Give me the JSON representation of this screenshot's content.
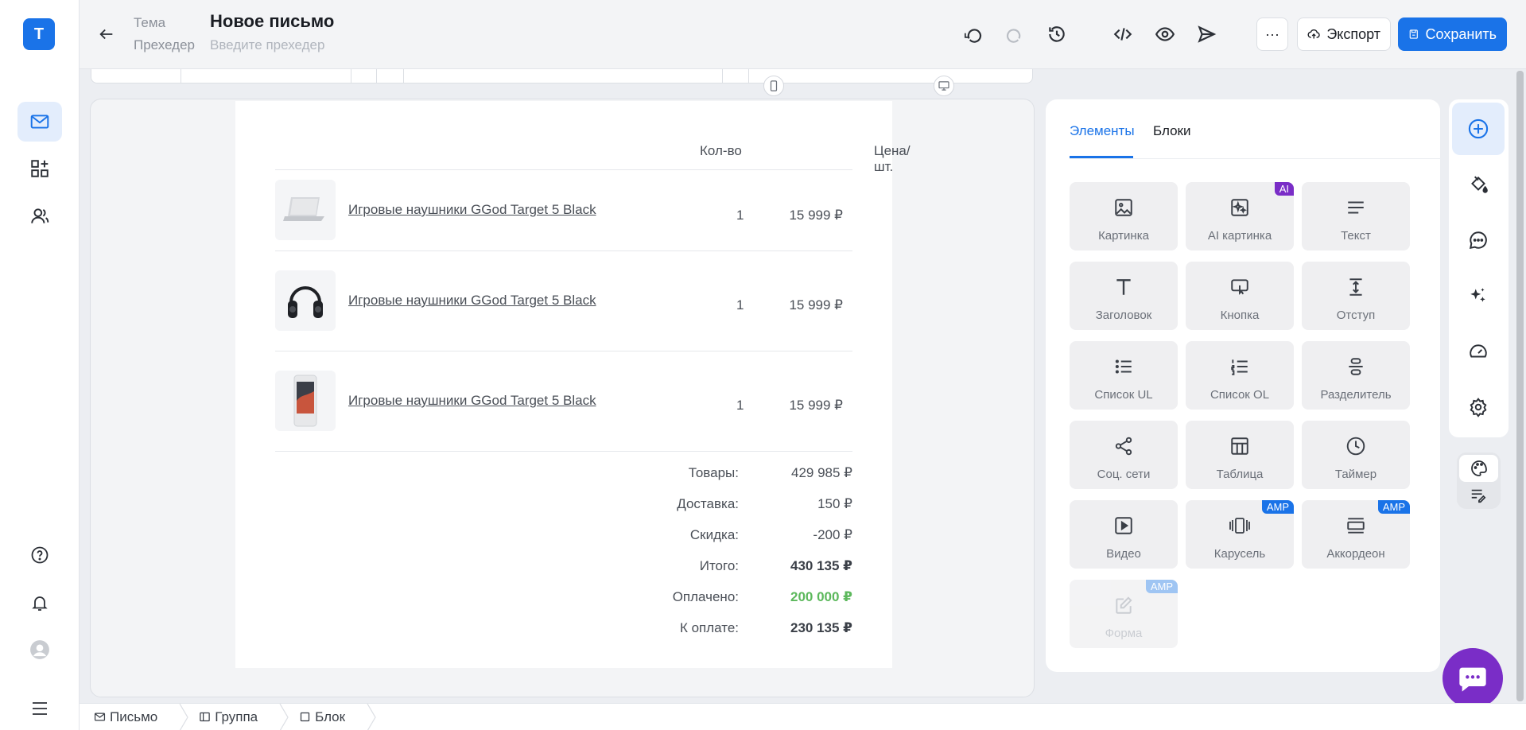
{
  "app": {
    "logo_letter": "T"
  },
  "left_nav": {
    "items": [
      {
        "name": "mail-icon",
        "active": true
      },
      {
        "name": "blocks-icon",
        "active": false
      },
      {
        "name": "contacts-icon",
        "active": false
      }
    ],
    "bottom": [
      "help-icon",
      "bell-icon",
      "avatar",
      "menu-icon"
    ]
  },
  "header": {
    "topic_label": "Тема",
    "preheader_label": "Прехедер",
    "title": "Новое письмо",
    "preheader_placeholder": "Введите прехедер",
    "more_label": "···",
    "export_label": "Экспорт",
    "save_label": "Сохранить"
  },
  "email": {
    "columns": {
      "qty": "Кол-во",
      "price": "Цена/шт."
    },
    "products": [
      {
        "name": "Игровые наушники GGod Target 5 Black",
        "qty": "1",
        "price": "15 999 ₽",
        "image": "laptop-image"
      },
      {
        "name": "Игровые наушники GGod Target 5 Black",
        "qty": "1",
        "price": "15 999 ₽",
        "image": "headphones-image"
      },
      {
        "name": "Игровые наушники GGod Target 5 Black",
        "qty": "1",
        "price": "15 999 ₽",
        "image": "phone-image"
      }
    ],
    "summary": [
      {
        "label": "Товары:",
        "value": "429 985 ₽",
        "style": "normal"
      },
      {
        "label": "Доставка:",
        "value": "150 ₽",
        "style": "normal"
      },
      {
        "label": "Скидка:",
        "value": "-200 ₽",
        "style": "normal"
      },
      {
        "label": "Итого:",
        "value": "430 135 ₽",
        "style": "bold"
      },
      {
        "label": "Оплачено:",
        "value": "200 000 ₽",
        "style": "green"
      },
      {
        "label": "К оплате:",
        "value": "230 135 ₽",
        "style": "bold"
      }
    ]
  },
  "panel": {
    "tabs": [
      "Элементы",
      "Блоки"
    ],
    "active_tab": "Элементы",
    "tiles": [
      {
        "label": "Картинка",
        "icon": "image-icon",
        "badge": ""
      },
      {
        "label": "AI картинка",
        "icon": "ai-image-icon",
        "badge": "AI"
      },
      {
        "label": "Текст",
        "icon": "text-lines-icon",
        "badge": ""
      },
      {
        "label": "Заголовок",
        "icon": "heading-icon",
        "badge": ""
      },
      {
        "label": "Кнопка",
        "icon": "button-icon",
        "badge": ""
      },
      {
        "label": "Отступ",
        "icon": "spacer-icon",
        "badge": ""
      },
      {
        "label": "Список UL",
        "icon": "list-ul-icon",
        "badge": ""
      },
      {
        "label": "Список OL",
        "icon": "list-ol-icon",
        "badge": ""
      },
      {
        "label": "Разделитель",
        "icon": "divider-icon",
        "badge": ""
      },
      {
        "label": "Соц. сети",
        "icon": "share-icon",
        "badge": ""
      },
      {
        "label": "Таблица",
        "icon": "table-icon",
        "badge": ""
      },
      {
        "label": "Таймер",
        "icon": "clock-icon",
        "badge": ""
      },
      {
        "label": "Видео",
        "icon": "video-icon",
        "badge": ""
      },
      {
        "label": "Карусель",
        "icon": "carousel-icon",
        "badge": "AMP"
      },
      {
        "label": "Аккордеон",
        "icon": "accordion-icon",
        "badge": "AMP"
      },
      {
        "label": "Форма",
        "icon": "form-icon",
        "badge": "AMP"
      }
    ]
  },
  "breadcrumbs": [
    "Письмо",
    "Группа",
    "Блок"
  ],
  "colors": {
    "accent": "#1a73e8",
    "ai_badge": "#7a2dc7",
    "paid_green": "#5cb85c",
    "chat_fab": "#7a2dc7"
  }
}
